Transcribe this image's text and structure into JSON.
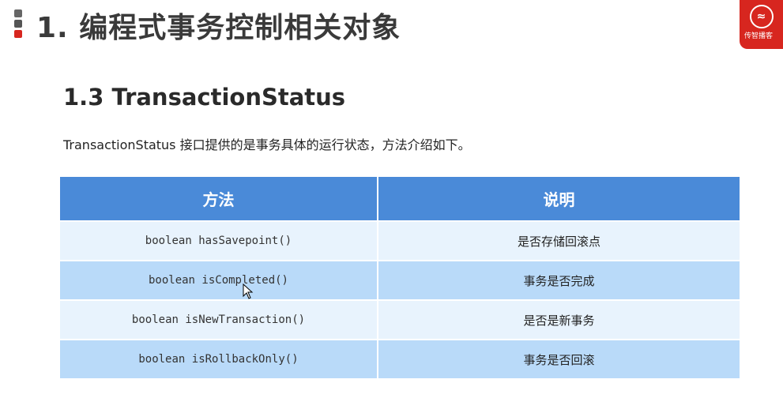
{
  "slide": {
    "title": "1. 编程式事务控制相关对象",
    "logo_text": "传智播客"
  },
  "section": {
    "title": "1.3 TransactionStatus",
    "intro": "TransactionStatus 接口提供的是事务具体的运行状态，方法介绍如下。"
  },
  "table": {
    "headers": [
      "方法",
      "说明"
    ],
    "rows": [
      {
        "method": "boolean hasSavepoint()",
        "desc": "是否存储回滚点"
      },
      {
        "method": "boolean isCompleted()",
        "desc": "事务是否完成"
      },
      {
        "method": "boolean isNewTransaction()",
        "desc": "是否是新事务"
      },
      {
        "method": "boolean isRollbackOnly()",
        "desc": "事务是否回滚"
      }
    ]
  },
  "colors": {
    "accent": "#d7261f",
    "header": "#4a8ad8",
    "row_light": "#e8f3fd",
    "row_mid": "#b9daf9"
  }
}
